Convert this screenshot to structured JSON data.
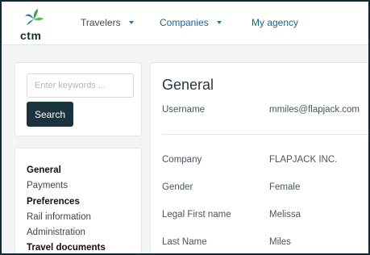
{
  "brand": {
    "name": "ctm"
  },
  "nav": {
    "items": [
      {
        "label": "Travelers",
        "has_dropdown": true
      },
      {
        "label": "Companies",
        "has_dropdown": true
      },
      {
        "label": "My agency",
        "has_dropdown": false
      }
    ]
  },
  "search": {
    "placeholder": "Enter keywords ...",
    "value": "",
    "button_label": "Search"
  },
  "sidebar": {
    "items": [
      {
        "label": "General",
        "active": true
      },
      {
        "label": "Payments",
        "active": false
      },
      {
        "label": "Preferences",
        "active": false
      },
      {
        "label": "Rail information",
        "active": false
      },
      {
        "label": "Administration",
        "active": false
      },
      {
        "label": "Travel documents",
        "active": false
      }
    ]
  },
  "main": {
    "title": "General",
    "username": {
      "label": "Username",
      "value": "mmiles@flapjack.com"
    },
    "fields": [
      {
        "label": "Company",
        "value": "FLAPJACK INC."
      },
      {
        "label": "Gender",
        "value": "Female"
      },
      {
        "label": "Legal First name",
        "value": "Melissa"
      },
      {
        "label": "Last Name",
        "value": "Miles"
      }
    ]
  },
  "colors": {
    "background": "#0f2a33",
    "button": "#1b333d",
    "nav_link": "#1f5f86",
    "logo_green": "#3ea34a",
    "logo_blue": "#2a6f9f"
  }
}
